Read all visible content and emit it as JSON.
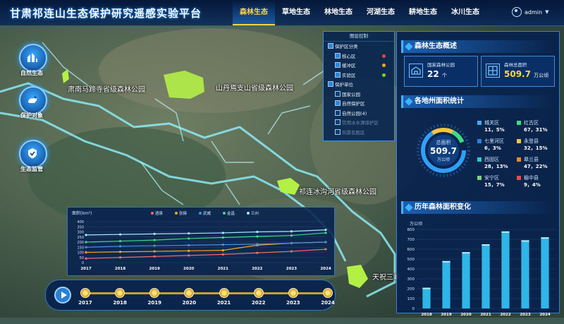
{
  "app": {
    "title": "甘肃祁连山生态保护研究遥感实验平台",
    "user": "admin"
  },
  "nav": {
    "tabs": [
      "森林生态",
      "草地生态",
      "林地生态",
      "河湖生态",
      "耕地生态",
      "冰川生态"
    ],
    "active": "森林生态"
  },
  "left_nav": [
    {
      "label": "自然生态",
      "icon": "ecology-icon"
    },
    {
      "label": "保护对象",
      "icon": "protected-object-icon"
    },
    {
      "label": "生态监管",
      "icon": "eco-supervision-icon"
    }
  ],
  "map_labels": [
    "肃南马蹄寺省级森林公园",
    "山丹焉支山省级森林公园",
    "祁连冰沟河省级森林公园",
    "天祝三峡"
  ],
  "layer_control": {
    "title": "图层控制",
    "items": [
      {
        "label": "保护区分类",
        "checked": true,
        "level": 0
      },
      {
        "label": "核心区",
        "checked": true,
        "level": 1,
        "color": "#e8463c"
      },
      {
        "label": "缓冲区",
        "checked": true,
        "level": 1,
        "color": "#f5a623"
      },
      {
        "label": "实验区",
        "checked": true,
        "level": 1,
        "color": "#7ed321"
      },
      {
        "label": "保护单位",
        "checked": true,
        "level": 0
      },
      {
        "label": "国家公园",
        "checked": false,
        "level": 1
      },
      {
        "label": "自然保护区",
        "checked": true,
        "level": 1
      },
      {
        "label": "自然公园(4)",
        "checked": false,
        "level": 1,
        "expand": true
      },
      {
        "label": "饮用水水源保护区",
        "checked": false,
        "level": 1,
        "dim": true
      },
      {
        "label": "风景名胜区",
        "checked": false,
        "level": 1,
        "dim": true
      }
    ]
  },
  "overview": {
    "title": "森林生态概述",
    "cards": [
      {
        "label": "国家森林公园",
        "value": "22",
        "unit": "个",
        "icon": "forest-park-icon"
      },
      {
        "label": "森林总面积",
        "value": "509.7",
        "unit": "万公顷",
        "icon": "forest-area-icon"
      }
    ]
  },
  "area_stats": {
    "title": "各地州面积统计",
    "total_label": "总面积",
    "total_value": "509.7",
    "total_unit": "万公顷",
    "items": [
      {
        "name": "城关区",
        "value": "11，5%",
        "color": "#3fa9f5"
      },
      {
        "name": "红古区",
        "value": "67，31%",
        "color": "#3ddc84"
      },
      {
        "name": "七里河区",
        "value": "6，3%",
        "color": "#2f7fe0"
      },
      {
        "name": "永登县",
        "value": "32，15%",
        "color": "#f5c542"
      },
      {
        "name": "西固区",
        "value": "28，13%",
        "color": "#1fd1d1"
      },
      {
        "name": "皋兰县",
        "value": "47，22%",
        "color": "#f08a24"
      },
      {
        "name": "安宁区",
        "value": "15，7%",
        "color": "#7ad37a"
      },
      {
        "name": "榆中县",
        "value": "9，4%",
        "color": "#e64a4a"
      }
    ]
  },
  "history": {
    "title": "历年森林面积变化",
    "chart_data": {
      "type": "bar",
      "ylabel": "万公顷",
      "ylim": [
        0,
        800
      ],
      "yticks": [
        0,
        100,
        200,
        300,
        400,
        500,
        600,
        700,
        800
      ],
      "categories": [
        "2018",
        "2019",
        "2020",
        "2021",
        "2022",
        "2023",
        "2024"
      ],
      "values": [
        210,
        480,
        570,
        650,
        780,
        690,
        720
      ]
    }
  },
  "line_chart": {
    "chart_data": {
      "type": "line",
      "ylabel": "面积(km²)",
      "ylim": [
        0,
        400
      ],
      "yticks": [
        0,
        50,
        100,
        150,
        200,
        250,
        300,
        350,
        400
      ],
      "x": [
        "2017",
        "2018",
        "2019",
        "2020",
        "2021",
        "2022",
        "2023",
        "2024"
      ],
      "series": [
        {
          "name": "酒泉",
          "color": "#f46b6b",
          "values": [
            40,
            50,
            60,
            70,
            80,
            95,
            110,
            130
          ]
        },
        {
          "name": "张掖",
          "color": "#f5a623",
          "values": [
            100,
            105,
            110,
            115,
            120,
            170,
            190,
            200
          ]
        },
        {
          "name": "武威",
          "color": "#4a90e2",
          "values": [
            150,
            160,
            165,
            170,
            175,
            180,
            190,
            200
          ]
        },
        {
          "name": "金昌",
          "color": "#3ddc84",
          "values": [
            200,
            210,
            220,
            235,
            245,
            255,
            265,
            290
          ]
        },
        {
          "name": "兰州",
          "color": "#a4e8ff",
          "values": [
            270,
            275,
            280,
            285,
            290,
            300,
            305,
            320
          ]
        }
      ]
    }
  },
  "timeline": {
    "years": [
      "2017",
      "2018",
      "2019",
      "2020",
      "2021",
      "2022",
      "2023",
      "2024"
    ]
  }
}
